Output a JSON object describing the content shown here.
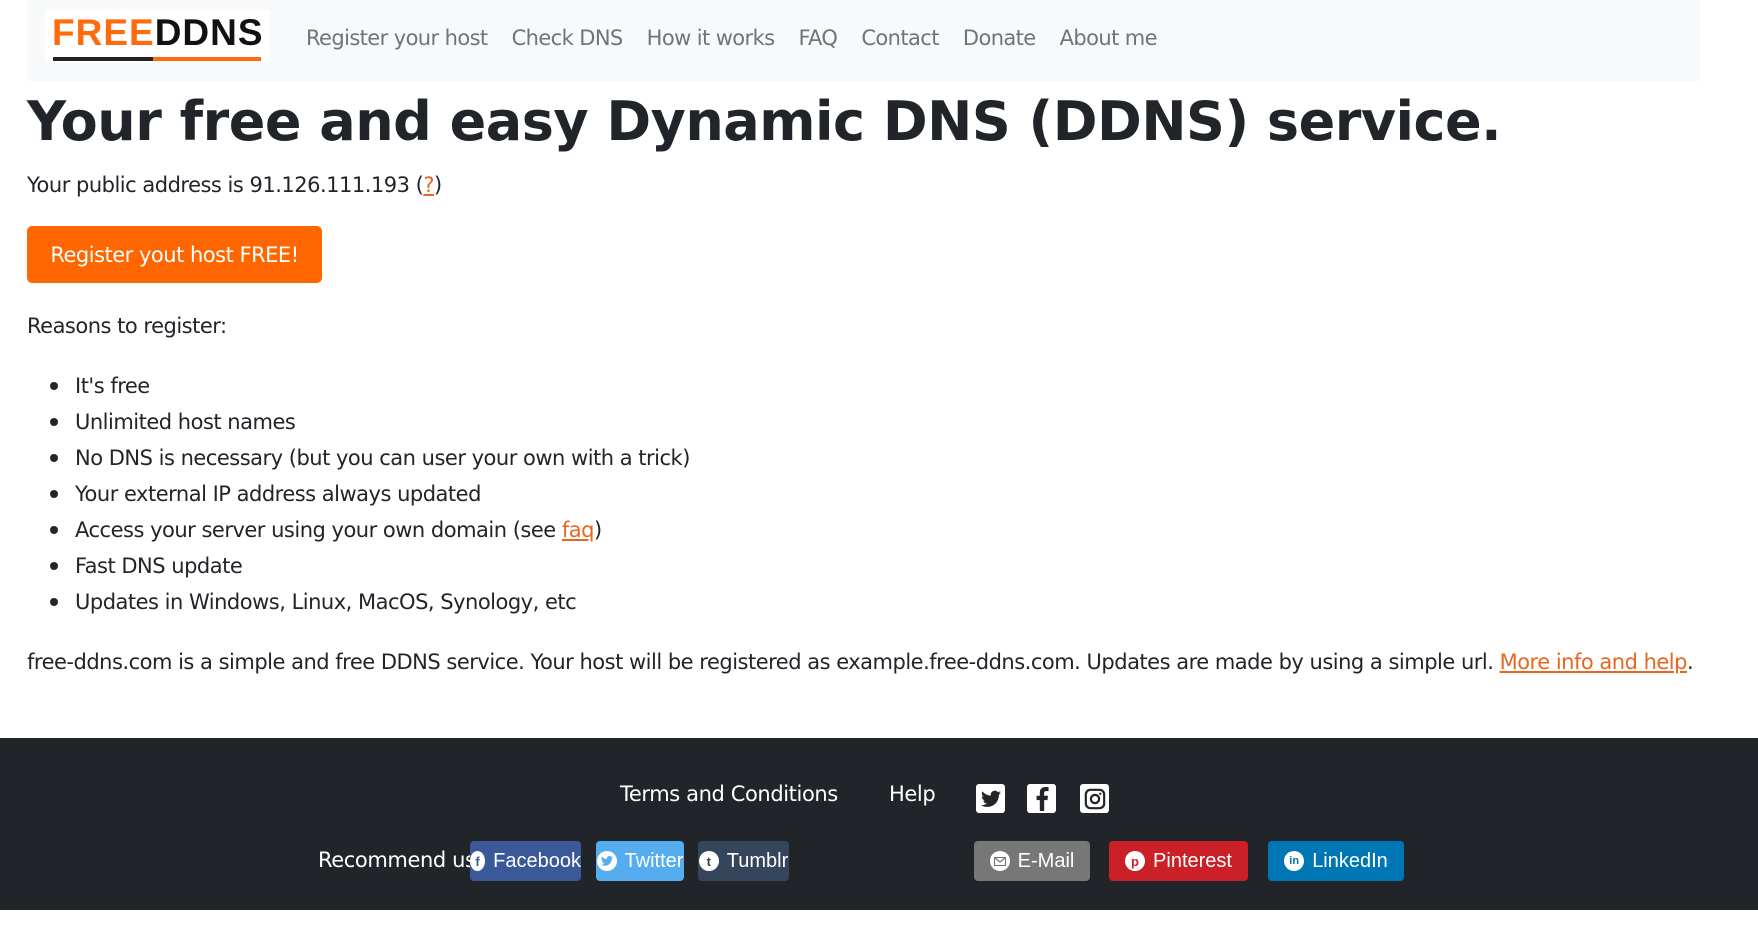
{
  "navbar": {
    "logo": {
      "part1": "FREE",
      "part2": "DDNS"
    },
    "links": [
      "Register your host",
      "Check DNS",
      "How it works",
      "FAQ",
      "Contact",
      "Donate",
      "About me"
    ]
  },
  "hero": {
    "title": "Your free and easy Dynamic DNS (DDNS) service.",
    "address_prefix": "Your public address is 91.126.111.193 (",
    "address_help_link": "?",
    "address_suffix": ")",
    "cta_label": "Register yout host FREE!"
  },
  "reasons": {
    "label": "Reasons to register:",
    "items": [
      {
        "text": "It's free"
      },
      {
        "text": "Unlimited host names"
      },
      {
        "text": "No DNS is necessary (but you can user your own with a trick)"
      },
      {
        "text": "Your external IP address always updated"
      },
      {
        "text": "Access your server using your own domain (see ",
        "link": "faq",
        "after": ")"
      },
      {
        "text": "Fast DNS update"
      },
      {
        "text": "Updates in Windows, Linux, MacOS, Synology, etc"
      }
    ]
  },
  "about": {
    "text": "free-ddns.com is a simple and free DDNS service. Your host will be registered as example.free-ddns.com. Updates are made by using a simple url. ",
    "link": "More info and help",
    "after": "."
  },
  "footer": {
    "links": [
      "Terms and Conditions",
      "Help"
    ],
    "social_icons": [
      "twitter-icon",
      "facebook-icon",
      "instagram-icon"
    ],
    "recommend_label": "Recommend us on",
    "share_buttons": [
      {
        "label": "Facebook",
        "icon": "facebook-icon",
        "color": "#3b5998"
      },
      {
        "label": "Twitter",
        "icon": "twitter-icon",
        "color": "#55acee"
      },
      {
        "label": "Tumblr",
        "icon": "tumblr-icon",
        "color": "#35465c"
      },
      {
        "label": "E-Mail",
        "icon": "email-icon",
        "color": "#777777"
      },
      {
        "label": "Pinterest",
        "icon": "pinterest-icon",
        "color": "#cb2027"
      },
      {
        "label": "LinkedIn",
        "icon": "linkedin-icon",
        "color": "#0077b5"
      }
    ]
  },
  "colors": {
    "accent": "#ff6600",
    "link": "#e8661f",
    "footer_bg": "#212529",
    "navbar_bg": "#f8f9fa"
  }
}
